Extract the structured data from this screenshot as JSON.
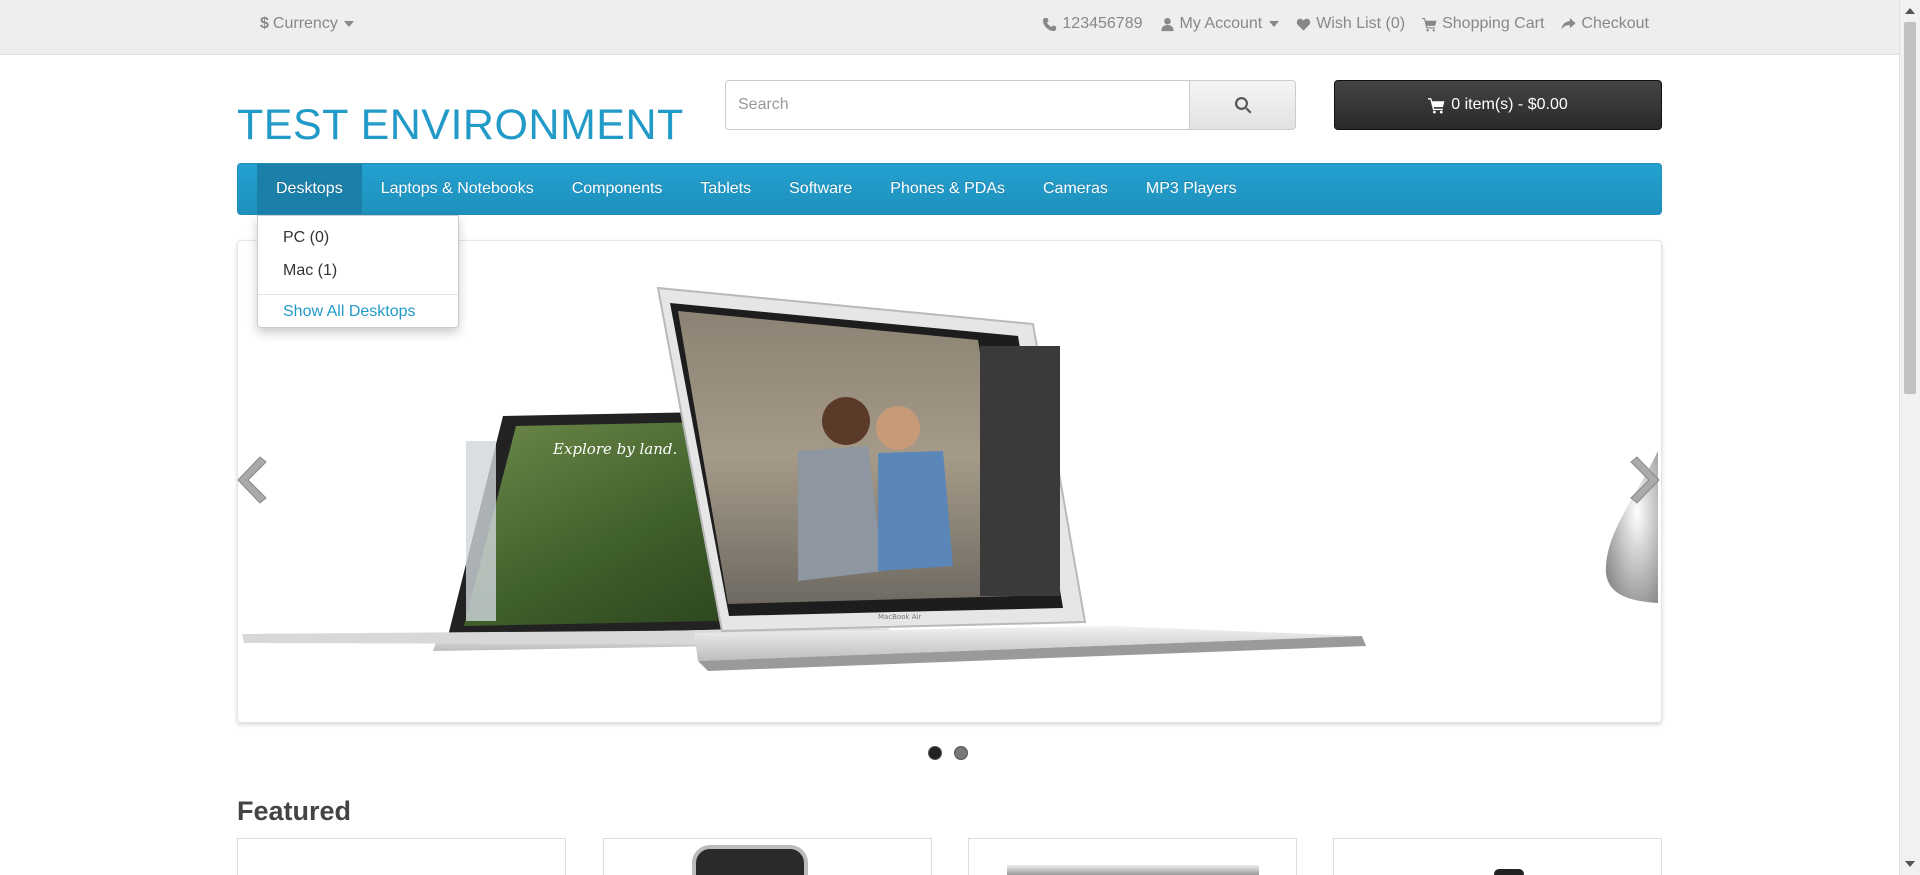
{
  "top_bar": {
    "currency_symbol": "$",
    "currency_label": "Currency",
    "phone": "123456789",
    "my_account": "My Account",
    "wish_list": "Wish List (0)",
    "shopping_cart": "Shopping Cart",
    "checkout": "Checkout"
  },
  "header": {
    "logo": "TEST ENVIRONMENT",
    "search_placeholder": "Search",
    "cart_summary": "0 item(s) - $0.00"
  },
  "menu": {
    "items": [
      "Desktops",
      "Laptops & Notebooks",
      "Components",
      "Tablets",
      "Software",
      "Phones & PDAs",
      "Cameras",
      "MP3 Players"
    ],
    "active": "Desktops"
  },
  "dropdown": {
    "items": [
      "PC (0)",
      "Mac (1)"
    ],
    "show_all": "Show All Desktops"
  },
  "slideshow": {
    "slide_count": 2,
    "active_slide": 1,
    "left_screen_text": "Explore by land.",
    "laptop_brand": "MacBook Air"
  },
  "featured": {
    "title": "Featured"
  },
  "colors": {
    "brand": "#229ac8",
    "menu": "#229ac8",
    "cart_button": "#363636"
  }
}
